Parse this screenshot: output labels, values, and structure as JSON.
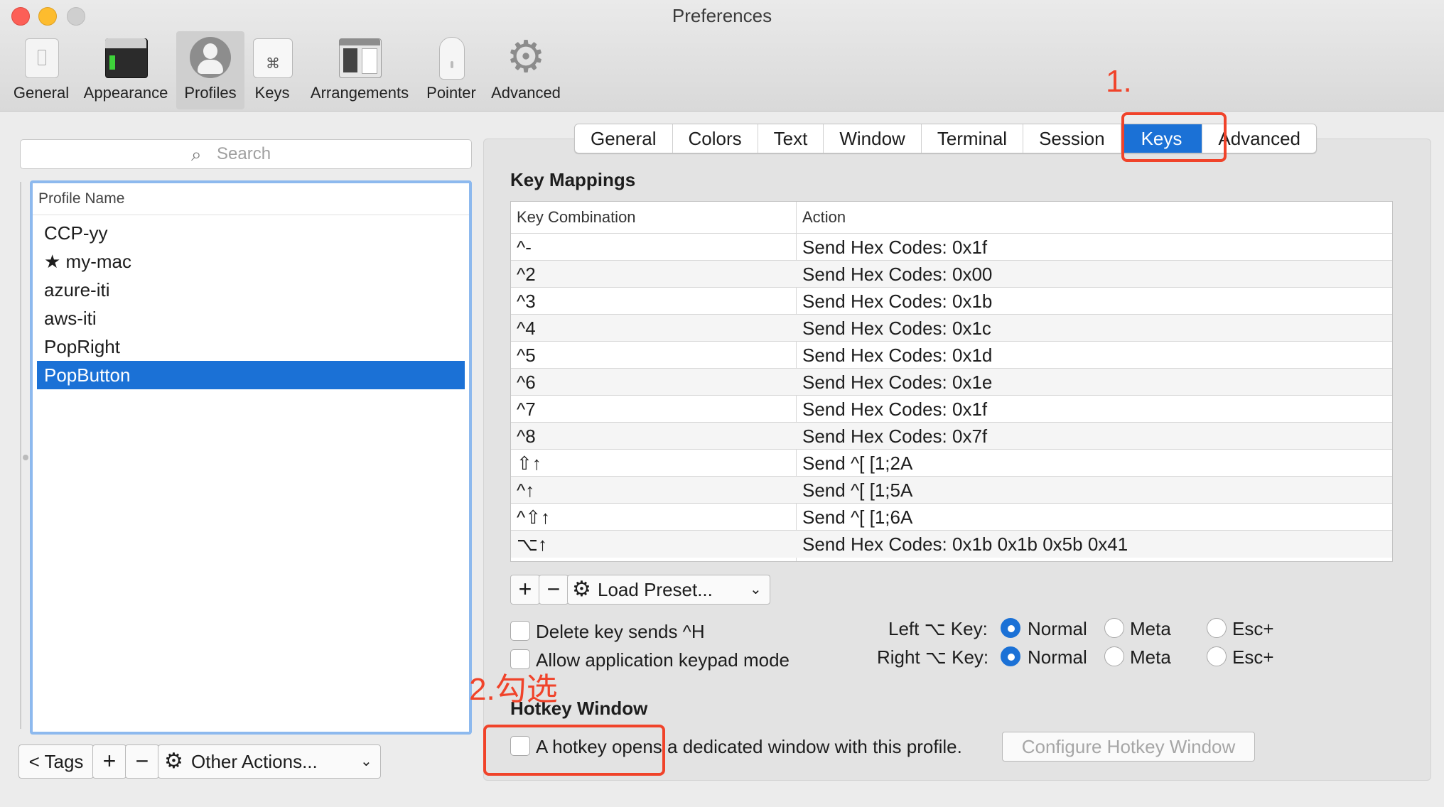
{
  "window": {
    "title": "Preferences"
  },
  "toolbar": {
    "items": [
      {
        "label": "General",
        "icon": "general-icon"
      },
      {
        "label": "Appearance",
        "icon": "appearance-icon"
      },
      {
        "label": "Profiles",
        "icon": "profiles-icon",
        "selected": true
      },
      {
        "label": "Keys",
        "icon": "keys-icon"
      },
      {
        "label": "Arrangements",
        "icon": "arrangements-icon"
      },
      {
        "label": "Pointer",
        "icon": "pointer-icon"
      },
      {
        "label": "Advanced",
        "icon": "gear-icon"
      }
    ]
  },
  "sidebar": {
    "search_placeholder": "Search",
    "column_header": "Profile Name",
    "profiles": [
      "CCP-yy",
      "★ my-mac",
      "azure-iti",
      "aws-iti",
      "PopRight",
      "PopButton"
    ],
    "selected_profile": "PopButton",
    "tags_label": "< Tags",
    "add_label": "+",
    "remove_label": "−",
    "other_actions_label": "Other Actions..."
  },
  "tabs": {
    "items": [
      "General",
      "Colors",
      "Text",
      "Window",
      "Terminal",
      "Session",
      "Keys",
      "Advanced"
    ],
    "selected": "Keys"
  },
  "key_mappings": {
    "title": "Key Mappings",
    "col_key": "Key Combination",
    "col_action": "Action",
    "rows": [
      {
        "key": "^-",
        "action": "Send Hex Codes: 0x1f"
      },
      {
        "key": "^2",
        "action": "Send Hex Codes: 0x00"
      },
      {
        "key": "^3",
        "action": "Send Hex Codes: 0x1b"
      },
      {
        "key": "^4",
        "action": "Send Hex Codes: 0x1c"
      },
      {
        "key": "^5",
        "action": "Send Hex Codes: 0x1d"
      },
      {
        "key": "^6",
        "action": "Send Hex Codes: 0x1e"
      },
      {
        "key": "^7",
        "action": "Send Hex Codes: 0x1f"
      },
      {
        "key": "^8",
        "action": "Send Hex Codes: 0x7f"
      },
      {
        "key": "⇧↑",
        "action": "Send ^[ [1;2A"
      },
      {
        "key": "^↑",
        "action": "Send ^[ [1;5A"
      },
      {
        "key": "^⇧↑",
        "action": "Send ^[ [1;6A"
      },
      {
        "key": "⌥↑",
        "action": "Send Hex Codes: 0x1b 0x1b 0x5b 0x41"
      }
    ],
    "add_label": "+",
    "remove_label": "−",
    "load_preset_label": "Load Preset..."
  },
  "options": {
    "delete_key_label": "Delete key sends ^H",
    "delete_key_checked": false,
    "keypad_label": "Allow application keypad mode",
    "keypad_checked": false,
    "left_alt_label": "Left ⌥ Key:",
    "right_alt_label": "Right ⌥ Key:",
    "radio_normal": "Normal",
    "radio_meta": "Meta",
    "radio_esc": "Esc+",
    "left_alt_value": "Normal",
    "right_alt_value": "Normal"
  },
  "hotkey": {
    "title": "Hotkey Window",
    "checkbox_label": "A hotkey opens a dedicated window with this profile.",
    "checked": false,
    "configure_label": "Configure Hotkey Window"
  },
  "annotations": {
    "step1": "1.",
    "step2": "2.勾选",
    "color": "#f0432a"
  },
  "colors": {
    "accent": "#1b71d6",
    "annotation": "#f0432a"
  }
}
